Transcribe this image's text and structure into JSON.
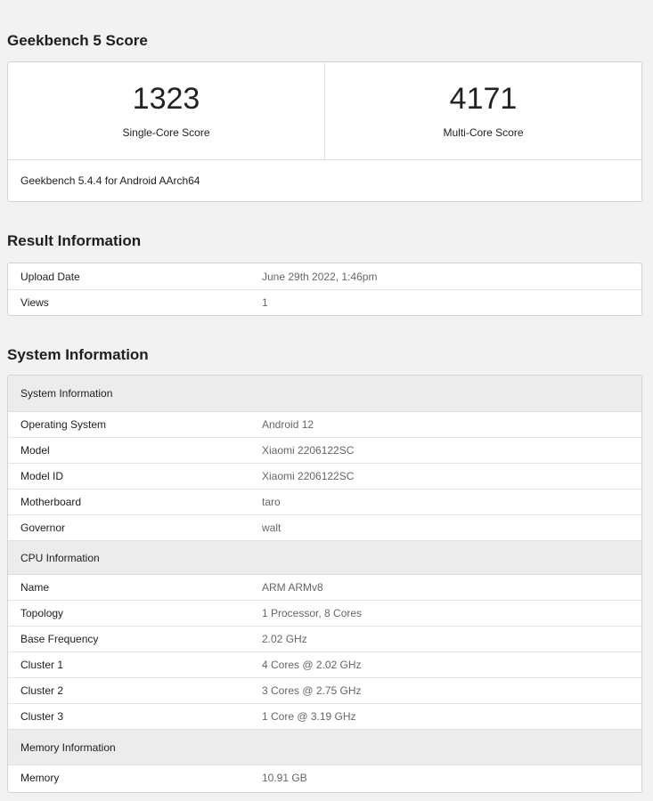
{
  "score_section": {
    "title": "Geekbench 5 Score",
    "single": {
      "value": "1323",
      "label": "Single-Core Score"
    },
    "multi": {
      "value": "4171",
      "label": "Multi-Core Score"
    },
    "version": "Geekbench 5.4.4 for Android AArch64"
  },
  "result_section": {
    "title": "Result Information",
    "rows": [
      {
        "key": "Upload Date",
        "value": "June 29th 2022, 1:46pm"
      },
      {
        "key": "Views",
        "value": "1"
      }
    ]
  },
  "system_section": {
    "title": "System Information",
    "groups": [
      {
        "header": "System Information",
        "rows": [
          {
            "key": "Operating System",
            "value": "Android 12"
          },
          {
            "key": "Model",
            "value": "Xiaomi 2206122SC"
          },
          {
            "key": "Model ID",
            "value": "Xiaomi 2206122SC"
          },
          {
            "key": "Motherboard",
            "value": "taro"
          },
          {
            "key": "Governor",
            "value": "walt"
          }
        ]
      },
      {
        "header": "CPU Information",
        "rows": [
          {
            "key": "Name",
            "value": "ARM ARMv8"
          },
          {
            "key": "Topology",
            "value": "1 Processor, 8 Cores"
          },
          {
            "key": "Base Frequency",
            "value": "2.02 GHz"
          },
          {
            "key": "Cluster 1",
            "value": "4 Cores @ 2.02 GHz"
          },
          {
            "key": "Cluster 2",
            "value": "3 Cores @ 2.75 GHz"
          },
          {
            "key": "Cluster 3",
            "value": "1 Core @ 3.19 GHz"
          }
        ]
      },
      {
        "header": "Memory Information",
        "rows": [
          {
            "key": "Memory",
            "value": "10.91 GB"
          }
        ]
      }
    ]
  }
}
